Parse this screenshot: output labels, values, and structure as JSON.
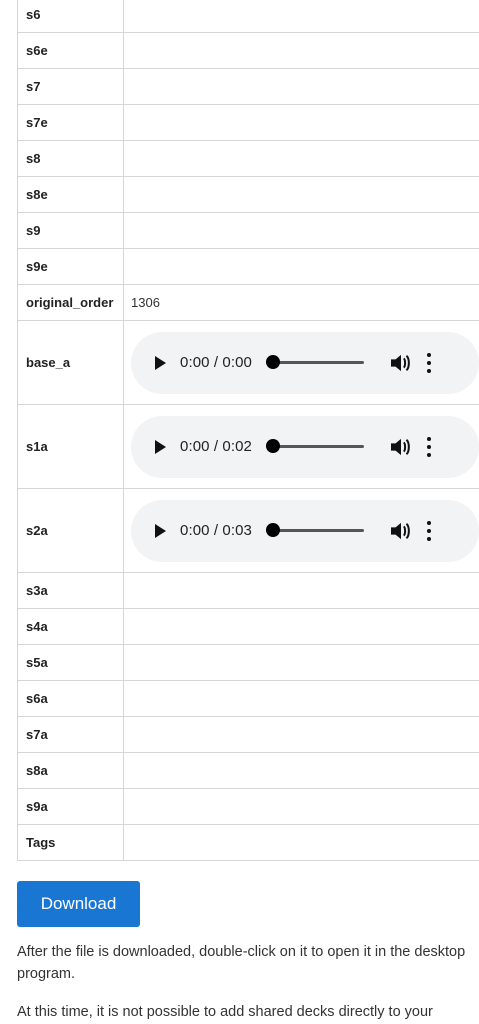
{
  "fields": [
    {
      "key": "s6",
      "value": ""
    },
    {
      "key": "s6e",
      "value": ""
    },
    {
      "key": "s7",
      "value": ""
    },
    {
      "key": "s7e",
      "value": ""
    },
    {
      "key": "s8",
      "value": ""
    },
    {
      "key": "s8e",
      "value": ""
    },
    {
      "key": "s9",
      "value": ""
    },
    {
      "key": "s9e",
      "value": ""
    },
    {
      "key": "original_order",
      "value": "1306"
    },
    {
      "key": "base_a",
      "audio_time": "0:00 / 0:00"
    },
    {
      "key": "s1a",
      "audio_time": "0:00 / 0:02"
    },
    {
      "key": "s2a",
      "audio_time": "0:00 / 0:03"
    },
    {
      "key": "s3a",
      "value": ""
    },
    {
      "key": "s4a",
      "value": ""
    },
    {
      "key": "s5a",
      "value": ""
    },
    {
      "key": "s6a",
      "value": ""
    },
    {
      "key": "s7a",
      "value": ""
    },
    {
      "key": "s8a",
      "value": ""
    },
    {
      "key": "s9a",
      "value": ""
    },
    {
      "key": "Tags",
      "value": ""
    }
  ],
  "download": {
    "label": "Download"
  },
  "info": [
    "After the file is downloaded, double-click on it to open it in the desktop program.",
    "At this time, it is not possible to add shared decks directly to your"
  ],
  "colors": {
    "button": "#1976d2",
    "player_bg": "#f1f3f4",
    "border": "#d6d6d6"
  },
  "icons": [
    "play-icon",
    "volume-icon",
    "more-options-icon"
  ]
}
